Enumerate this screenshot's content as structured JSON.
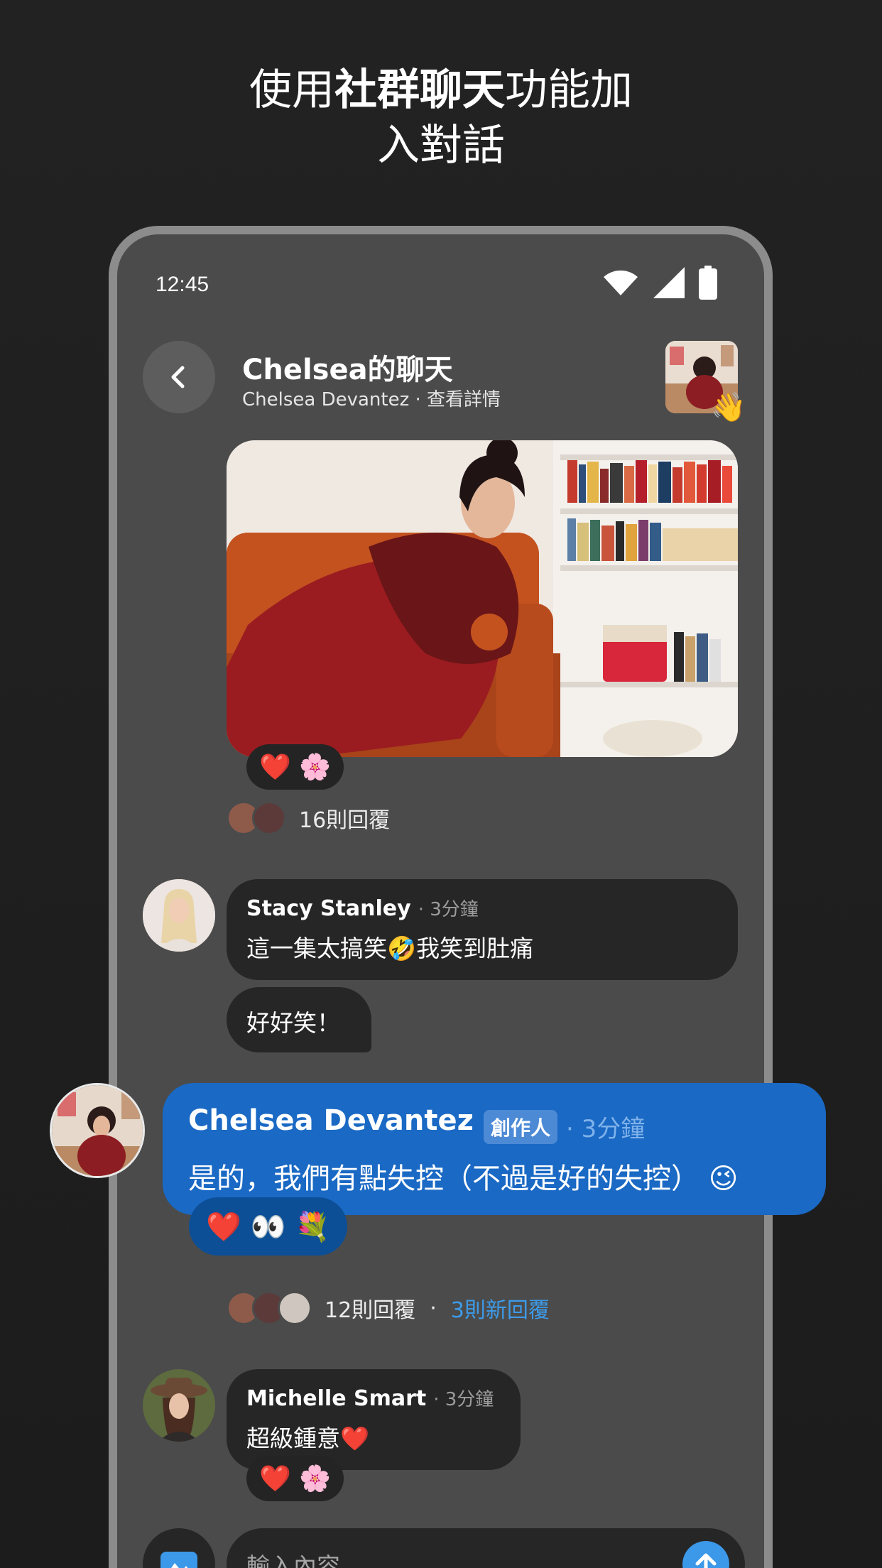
{
  "headline": {
    "line1_pre": "使用",
    "line1_bold": "社群聊天",
    "line1_post": "功能加",
    "line2": "入對話"
  },
  "status_bar": {
    "time": "12:45",
    "icons": [
      "wifi-icon",
      "signal-icon",
      "battery-icon"
    ]
  },
  "chat_header": {
    "title": "Chelsea的聊天",
    "subtitle": "Chelsea Devantez · 查看詳情",
    "back_icon": "chevron-left-icon",
    "wave_emoji": "👋"
  },
  "post": {
    "reactions": "❤️ 🌸",
    "reply_count": "16則回覆"
  },
  "messages": [
    {
      "author": "Stacy Stanley",
      "time": "· 3分鐘",
      "text": "這一集太搞笑🤣我笑到肚痛",
      "followup": "好好笑！"
    },
    {
      "author": "Chelsea Devantez",
      "badge": "創作人",
      "time": "· 3分鐘",
      "text": "是的，我們有點失控（不過是好的失控） 😉",
      "reactions": "❤️ 👀 💐",
      "reply_count": "12則回覆",
      "reply_separator": "·",
      "new_replies": "3則新回覆"
    },
    {
      "author": "Michelle Smart",
      "time": "· 3分鐘",
      "text": "超級鍾意❤️",
      "reactions": "❤️ 🌸"
    }
  ],
  "composer": {
    "placeholder": "輸入內容...",
    "media_icon": "image-icon",
    "send_icon": "arrow-up-icon"
  },
  "colors": {
    "background": "#1f1f1f",
    "phone": "#4b4b4b",
    "bubble": "#262626",
    "highlight": "#1a69c4",
    "accent": "#3d9be9"
  }
}
